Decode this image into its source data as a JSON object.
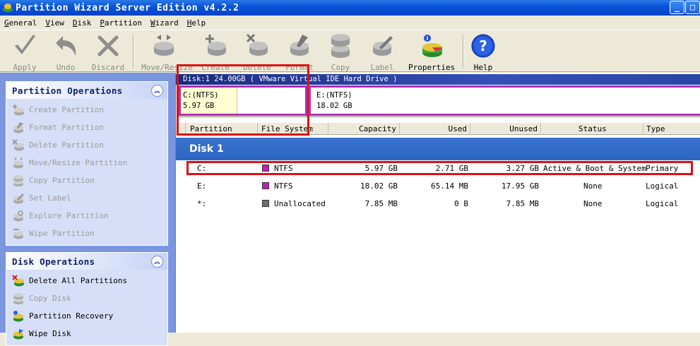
{
  "window": {
    "title": "Partition Wizard Server Edition v4.2.2",
    "minimize": "_",
    "maximize": "□"
  },
  "menu": [
    "General",
    "View",
    "Disk",
    "Partition",
    "Wizard",
    "Help"
  ],
  "toolbar": {
    "apply": "Apply",
    "undo": "Undo",
    "discard": "Discard",
    "move_resize": "Move/Resize",
    "create": "Create",
    "delete": "Delete",
    "format": "Format",
    "copy": "Copy",
    "label": "Label",
    "properties": "Properties",
    "help": "Help"
  },
  "partition_operations": {
    "title": "Partition Operations",
    "items": [
      "Create Partition",
      "Format Partition",
      "Delete Partition",
      "Move/Resize Partition",
      "Copy Partition",
      "Set Label",
      "Explore Partition",
      "Wipe Partition"
    ]
  },
  "disk_operations": {
    "title": "Disk Operations",
    "items": [
      "Delete All Partitions",
      "Copy Disk",
      "Partition Recovery",
      "Wipe Disk"
    ]
  },
  "disk_header": "Disk:1 24.00GB  ( VMware Virtual IDE Hard Drive )",
  "partition_map": [
    {
      "name": "C:(NTFS)",
      "size": "5.97 GB"
    },
    {
      "name": "E:(NTFS)",
      "size": "18.02 GB"
    }
  ],
  "columns": [
    "Partition",
    "File System",
    "Capacity",
    "Used",
    "Unused",
    "Status",
    "Type"
  ],
  "disk_label": "Disk 1",
  "rows": [
    {
      "partition": "C:",
      "fs": "NTFS",
      "fs_color": "#c020b8",
      "capacity": "5.97 GB",
      "used": "2.71 GB",
      "unused": "3.27 GB",
      "status": "Active & Boot & System",
      "type": "Primary"
    },
    {
      "partition": "E:",
      "fs": "NTFS",
      "fs_color": "#c020b8",
      "capacity": "18.02 GB",
      "used": "65.14 MB",
      "unused": "17.95 GB",
      "status": "None",
      "type": "Logical"
    },
    {
      "partition": "*:",
      "fs": "Unallocated",
      "fs_color": "#6e6e6e",
      "capacity": "7.85 MB",
      "used": "0 B",
      "unused": "7.85 MB",
      "status": "None",
      "type": "Logical"
    }
  ],
  "colors": {
    "titlebar": "#0a54d9",
    "left_panel": "#7a96df",
    "disk_row": "#3a73cf",
    "highlight_red": "#e01010",
    "highlight_magenta": "#b030b0"
  }
}
